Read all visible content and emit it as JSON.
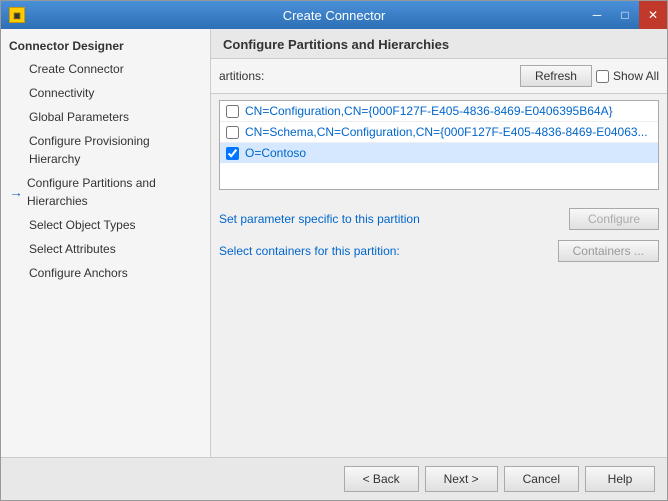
{
  "window": {
    "title": "Create Connector",
    "icon": "app-icon"
  },
  "titlebar": {
    "minimize_label": "─",
    "maximize_label": "□",
    "close_label": "✕"
  },
  "sidebar": {
    "header": "Connector Designer",
    "items": [
      {
        "id": "create-connector",
        "label": "Create Connector",
        "level": 1,
        "active": false
      },
      {
        "id": "connectivity",
        "label": "Connectivity",
        "level": 1,
        "active": false
      },
      {
        "id": "global-parameters",
        "label": "Global Parameters",
        "level": 1,
        "active": false
      },
      {
        "id": "configure-provisioning",
        "label": "Configure Provisioning Hierarchy",
        "level": 1,
        "active": false
      },
      {
        "id": "configure-partitions",
        "label": "Configure Partitions and Hierarchies",
        "level": 1,
        "active": true,
        "current": true
      },
      {
        "id": "select-object-types",
        "label": "Select Object Types",
        "level": 1,
        "active": false
      },
      {
        "id": "select-attributes",
        "label": "Select Attributes",
        "level": 1,
        "active": false
      },
      {
        "id": "configure-anchors",
        "label": "Configure Anchors",
        "level": 1,
        "active": false
      }
    ]
  },
  "main": {
    "header": "Configure Partitions and Hierarchies",
    "toolbar": {
      "partitions_label": "artitions:",
      "refresh_btn": "Refresh",
      "show_all_label": "Show All"
    },
    "partitions": [
      {
        "id": "partition-1",
        "label": "CN=Configuration,CN={000F127F-E405-4836-8469-E0406395B64A}",
        "checked": false,
        "selected": false
      },
      {
        "id": "partition-2",
        "label": "CN=Schema,CN=Configuration,CN={000F127F-E405-4836-8469-E04063...",
        "checked": false,
        "selected": false
      },
      {
        "id": "partition-3",
        "label": "O=Contoso",
        "checked": true,
        "selected": true
      }
    ],
    "param_label": "Set parameter specific to this partition",
    "configure_btn": "Configure",
    "containers_label": "Select containers for this partition:",
    "containers_btn": "Containers ..."
  },
  "footer": {
    "back_btn": "< Back",
    "next_btn": "Next >",
    "cancel_btn": "Cancel",
    "help_btn": "Help"
  }
}
